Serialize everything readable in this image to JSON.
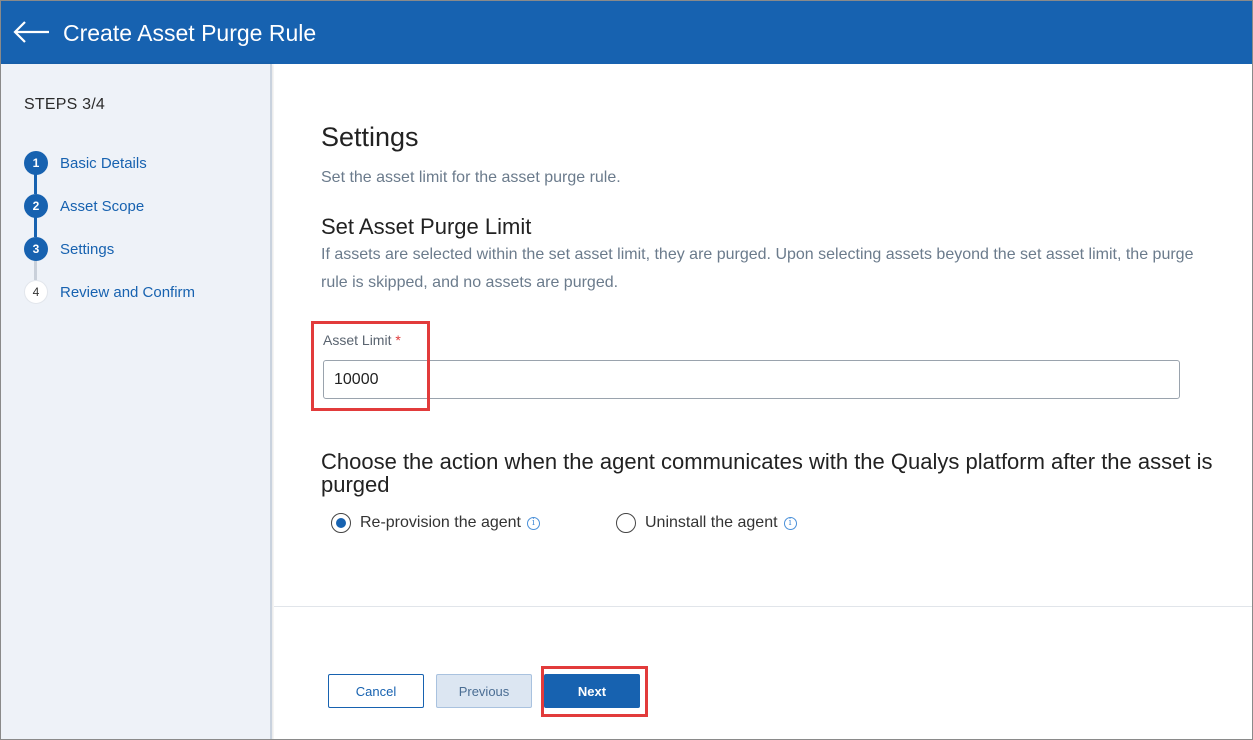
{
  "header": {
    "title": "Create Asset Purge Rule"
  },
  "sidebar": {
    "steps_title": "STEPS 3/4",
    "steps": [
      {
        "num": "1",
        "label": "Basic Details"
      },
      {
        "num": "2",
        "label": "Asset Scope"
      },
      {
        "num": "3",
        "label": "Settings"
      },
      {
        "num": "4",
        "label": "Review and Confirm"
      }
    ]
  },
  "main": {
    "heading": "Settings",
    "subheading": "Set the asset limit for the asset purge rule.",
    "limit_heading": "Set Asset Purge Limit",
    "limit_description": "If assets are selected within the set asset limit, they are purged. Upon selecting assets beyond the set asset limit, the purge rule is skipped, and no assets are purged.",
    "asset_limit_label": "Asset Limit",
    "required_mark": "*",
    "asset_limit_value": "10000",
    "action_heading": "Choose the action when the agent communicates with the Qualys platform after the asset is purged",
    "options": [
      {
        "label": "Re-provision the agent",
        "selected": true
      },
      {
        "label": "Uninstall the agent",
        "selected": false
      }
    ],
    "info_glyph": "i"
  },
  "footer": {
    "cancel_label": "Cancel",
    "previous_label": "Previous",
    "next_label": "Next"
  },
  "colors": {
    "primary": "#1762b0",
    "highlight": "#e23b3b",
    "sidebar_bg": "#eef2f8"
  }
}
